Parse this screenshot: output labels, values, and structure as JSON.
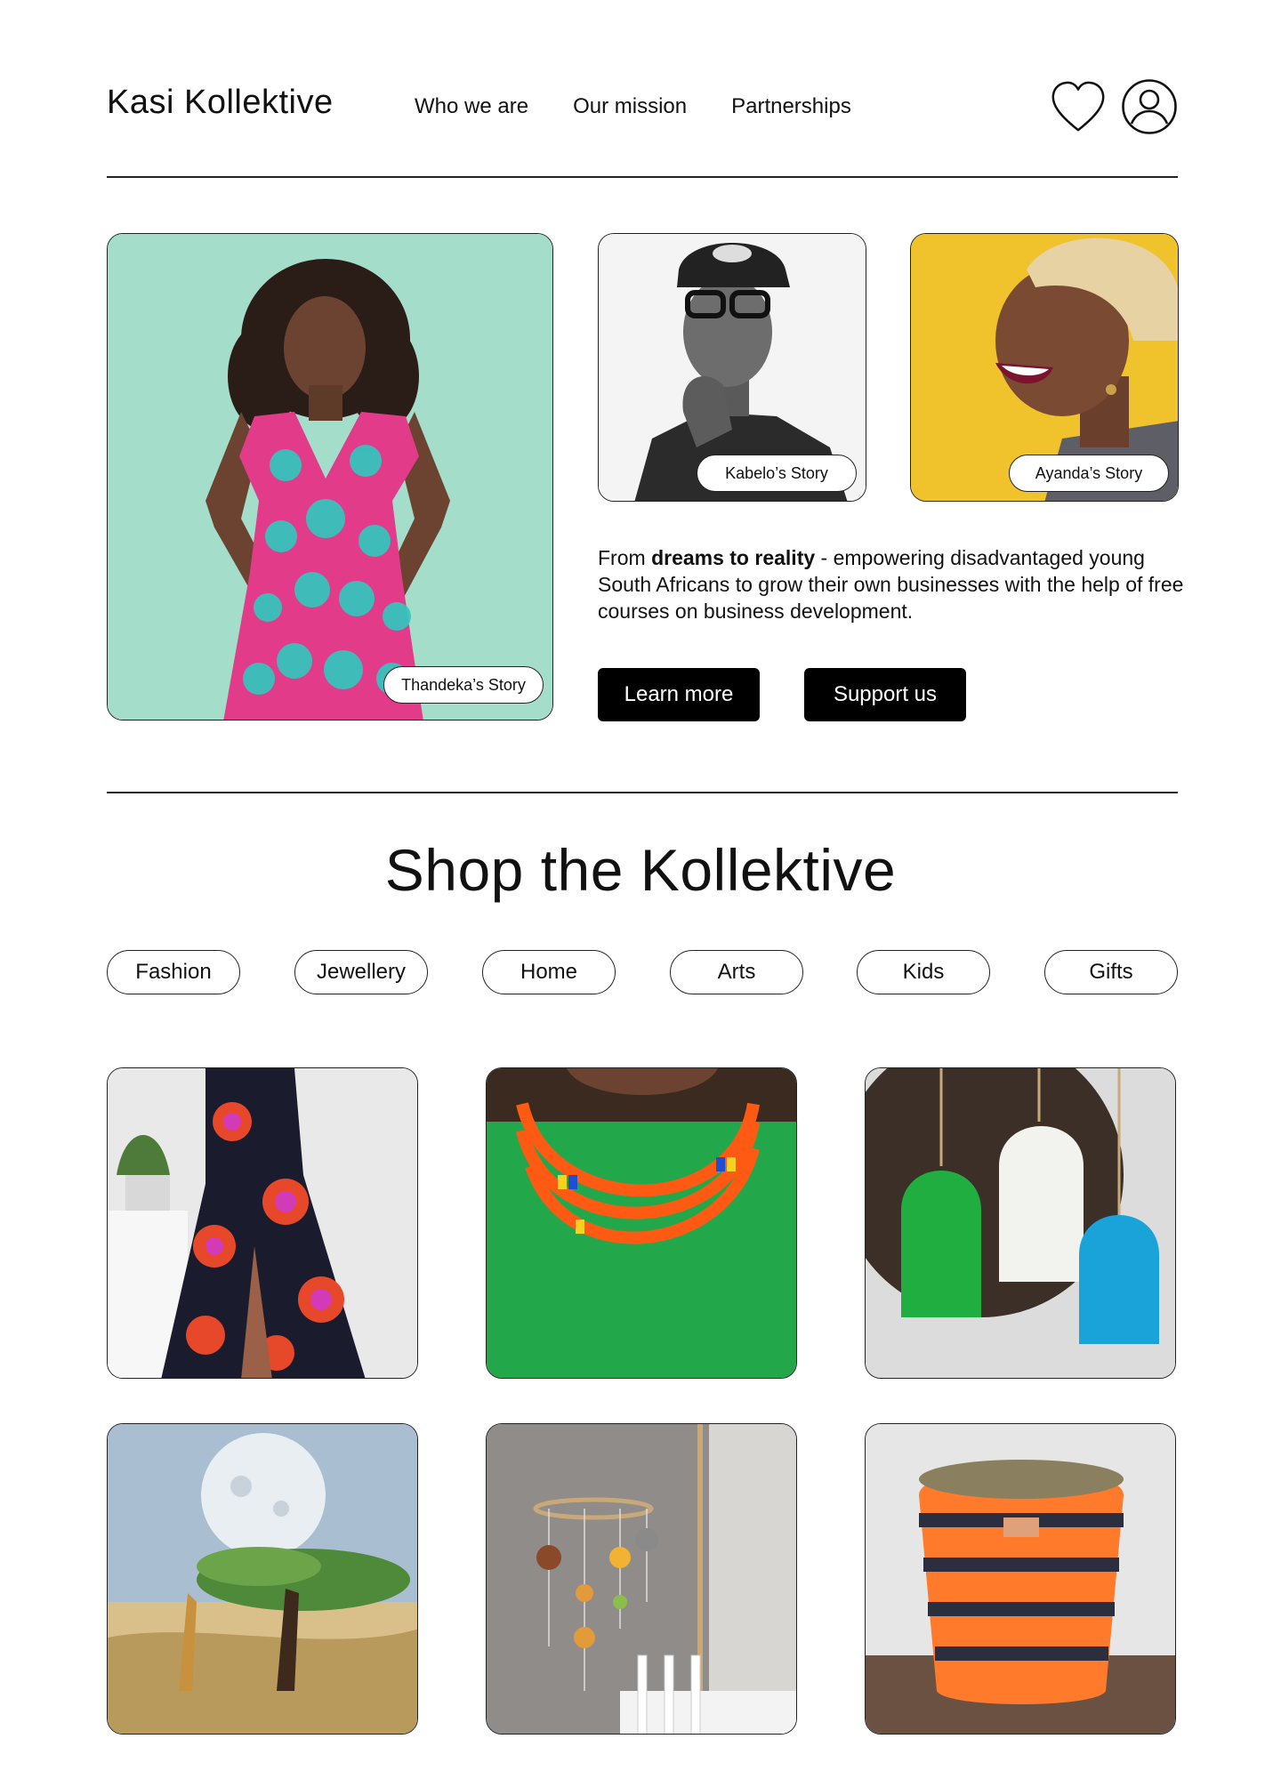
{
  "header": {
    "brand": "Kasi Kollektive",
    "nav": [
      "Who we are",
      "Our mission",
      "Partnerships"
    ],
    "icons": [
      "heart-icon",
      "user-account-icon"
    ]
  },
  "hero": {
    "stories": [
      {
        "label": "Thandeka’s Story"
      },
      {
        "label": "Kabelo’s Story"
      },
      {
        "label": "Ayanda’s Story"
      }
    ],
    "text_prefix": "From ",
    "text_bold": "dreams to reality",
    "text_suffix": " - empowering disadvantaged young South Africans to grow their own businesses with the help of free courses on business development.",
    "buttons": {
      "learn_more": "Learn more",
      "support_us": "Support us"
    }
  },
  "shop": {
    "title": "Shop the Kollektive",
    "categories": [
      "Fashion",
      "Jewellery",
      "Home",
      "Arts",
      "Kids",
      "Gifts"
    ],
    "products": [
      {
        "image": "printed-maxi-dress-photo"
      },
      {
        "image": "beaded-necklace-photo"
      },
      {
        "image": "woven-pendant-lamps-photo"
      },
      {
        "image": "acacia-giraffe-painting-photo"
      },
      {
        "image": "felt-animal-mobile-photo"
      },
      {
        "image": "woven-basket-photo"
      }
    ]
  },
  "colors": {
    "text": "#111111",
    "button_bg": "#000000",
    "button_text": "#ffffff",
    "border": "#222222",
    "hero_mint": "#9fdcc8",
    "hero_yellow": "#f1c232",
    "necklace_green": "#22a84a",
    "necklace_orange": "#ff5a14",
    "lamp_blue": "#1aa3d9"
  }
}
